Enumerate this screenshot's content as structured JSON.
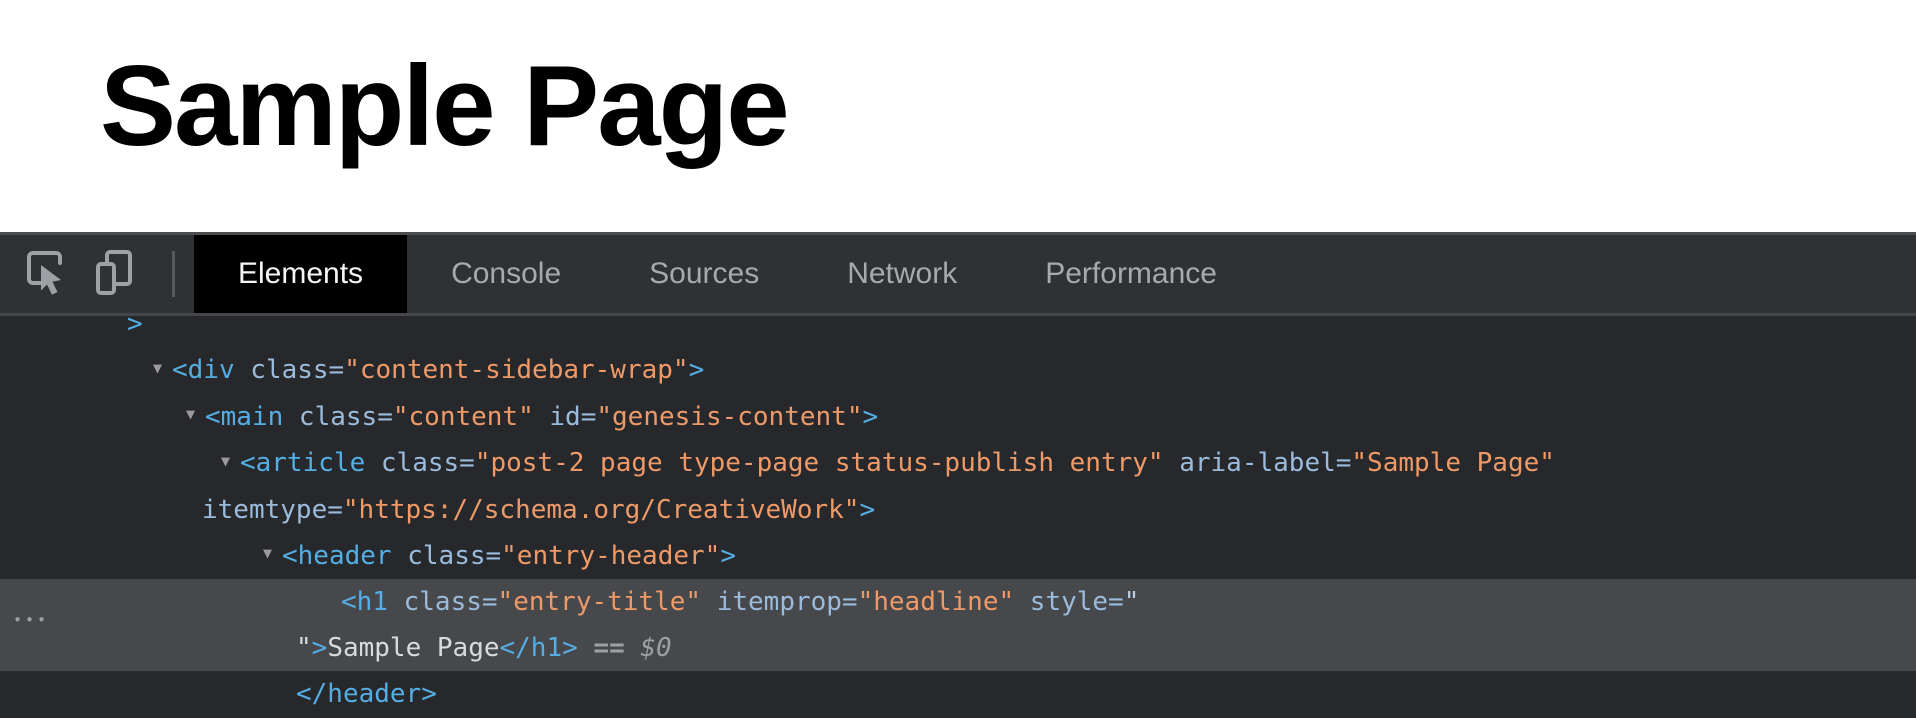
{
  "page": {
    "title": "Sample Page"
  },
  "devtools": {
    "toolbar": {
      "icons": [
        {
          "name": "inspect-element-icon"
        },
        {
          "name": "toggle-device-toolbar-icon"
        }
      ],
      "tabs": [
        {
          "label": "Elements",
          "active": true
        },
        {
          "label": "Console",
          "active": false
        },
        {
          "label": "Sources",
          "active": false
        },
        {
          "label": "Network",
          "active": false
        },
        {
          "label": "Performance",
          "active": false
        }
      ]
    },
    "tree": {
      "ellipsis": "•••",
      "lines": [
        {
          "pl": 127,
          "arrow": false,
          "selected": false,
          "tokens": [
            [
              "tag",
              ">"
            ]
          ]
        },
        {
          "pl": 153,
          "arrow": true,
          "selected": false,
          "tokens": [
            [
              "tag",
              "<div"
            ],
            [
              "attr",
              " class="
            ],
            [
              "val",
              "\"content-sidebar-wrap\""
            ],
            [
              "tag",
              ">"
            ]
          ]
        },
        {
          "pl": 186,
          "arrow": true,
          "selected": false,
          "tokens": [
            [
              "tag",
              "<main"
            ],
            [
              "attr",
              " class="
            ],
            [
              "val",
              "\"content\""
            ],
            [
              "attr",
              " id="
            ],
            [
              "val",
              "\"genesis-content\""
            ],
            [
              "tag",
              ">"
            ]
          ]
        },
        {
          "pl": 221,
          "arrow": true,
          "selected": false,
          "tokens": [
            [
              "tag",
              "<article"
            ],
            [
              "attr",
              " class="
            ],
            [
              "val",
              "\"post-2 page type-page status-publish entry\""
            ],
            [
              "attr",
              " aria-label="
            ],
            [
              "val",
              "\"Sample Page\""
            ]
          ]
        },
        {
          "pl": 202,
          "arrow": false,
          "selected": false,
          "tokens": [
            [
              "attr",
              "itemtype="
            ],
            [
              "val",
              "\"https://schema.org/CreativeWork\""
            ],
            [
              "tag",
              ">"
            ]
          ]
        },
        {
          "pl": 263,
          "arrow": true,
          "selected": false,
          "tokens": [
            [
              "tag",
              "<header"
            ],
            [
              "attr",
              " class="
            ],
            [
              "val",
              "\"entry-header\""
            ],
            [
              "tag",
              ">"
            ]
          ]
        },
        {
          "pl": 341,
          "arrow": false,
          "selected": true,
          "tokens": [
            [
              "tag",
              "<h1"
            ],
            [
              "attr",
              " class="
            ],
            [
              "val",
              "\"entry-title\""
            ],
            [
              "attr",
              " itemprop="
            ],
            [
              "val",
              "\"headline\""
            ],
            [
              "attr",
              " style="
            ],
            [
              "lq",
              "\""
            ]
          ]
        },
        {
          "pl": 296,
          "arrow": false,
          "selected": true,
          "tokens": [
            [
              "wq",
              "\""
            ],
            [
              "tag",
              ">"
            ],
            [
              "plain",
              "Sample Page"
            ],
            [
              "tag",
              "</h1>"
            ],
            [
              "eq",
              " == "
            ],
            [
              "dollar",
              "$0"
            ]
          ]
        },
        {
          "pl": 296,
          "arrow": false,
          "selected": false,
          "tokens": [
            [
              "tag",
              "</header>"
            ]
          ]
        }
      ]
    }
  },
  "colors": {
    "tag": "#54aee3",
    "attr": "#9bbbdc",
    "val": "#ee9a68",
    "text": "#d8dadb",
    "sel": "#47484b",
    "panel": "#27282b",
    "toolbar": "#2f3134",
    "muted": "#9aa0a6"
  }
}
